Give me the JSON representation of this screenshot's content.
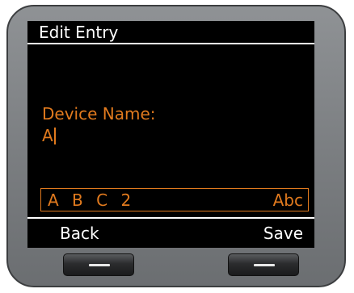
{
  "screen": {
    "title": "Edit Entry",
    "field_label": "Device Name:",
    "field_value": "A"
  },
  "input_bar": {
    "characters": "A B C 2",
    "mode": "Abc"
  },
  "softkeys": {
    "left": "Back",
    "right": "Save"
  },
  "colors": {
    "accent": "#e17a1e",
    "screen_bg": "#000000",
    "text": "#ffffff"
  },
  "icons": {
    "hardware_button": "dash-icon"
  }
}
